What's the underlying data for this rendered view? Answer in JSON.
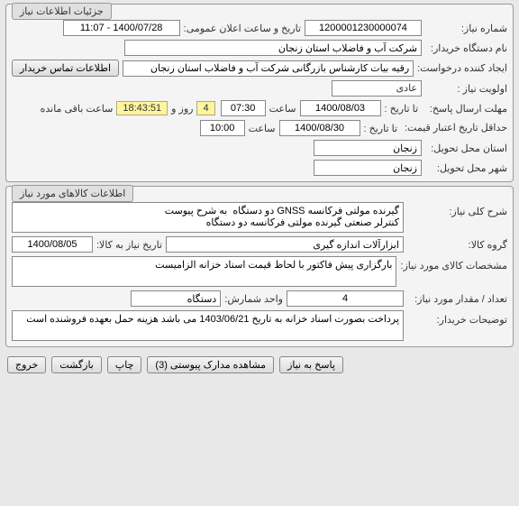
{
  "panel1": {
    "title": "جزئیات اطلاعات نیاز"
  },
  "need_no_label": "شماره نیاز:",
  "need_no": "1200001230000074",
  "public_date_label": "تاریخ و ساعت اعلان عمومی:",
  "public_date": "1400/07/28 - 11:07",
  "buyer_org_label": "نام دستگاه خریدار:",
  "buyer_org": "شرکت آب و فاضلاب استان زنجان",
  "creator_label": "ایجاد کننده درخواست:",
  "creator": "رقیه بیات کارشناس بازرگانی شرکت آب و فاضلاب استان زنجان",
  "contact_btn": "اطلاعات تماس خریدار",
  "priority_label": "اولویت نیاز :",
  "priority": "عادی",
  "response_deadline_label": "مهلت ارسال پاسخ:",
  "to_date": "تا تاریخ :",
  "resp_date": "1400/08/03",
  "time_label": "ساعت",
  "resp_time": "07:30",
  "remain_days": "4",
  "remain_word1": "روز و",
  "remain_time": "18:43:51",
  "remain_word2": "ساعت باقی مانده",
  "price_valid_label": "حداقل تاریخ اعتبار\nقیمت:",
  "price_date": "1400/08/30",
  "price_time": "10:00",
  "delivery_prov_label": "استان محل تحویل:",
  "delivery_prov": "زنجان",
  "delivery_city_label": "شهر محل تحویل:",
  "delivery_city": "زنجان",
  "panel2": {
    "title": "اطلاعات کالاهای مورد نیاز"
  },
  "desc_label": "شرح کلی نیاز:",
  "desc": "گیرنده مولتی فرکانسه GNSS دو دستگاه  به شرح پیوست\nکنترلر صنعتی گیرنده مولتی فرکانسه دو دستگاه",
  "group_label": "گروه کالا:",
  "group": "ابزارآلات اندازه گیری",
  "need_to_date_label": "تاریخ نیاز به کالا:",
  "need_to_date": "1400/08/05",
  "spec_label": "مشخصات کالای مورد نیاز:",
  "spec": "بارگزاری پیش فاکتور با لحاظ قیمت اسناد خزانه الزامیست",
  "qty_label": "تعداد / مقدار مورد نیاز:",
  "qty": "4",
  "unit_label": "واحد شمارش:",
  "unit": "دستگاه",
  "buyer_note_label": "توضیحات خریدار:",
  "buyer_note": "پرداخت بصورت اسناد خزانه به تاریخ 1403/06/21 می باشد هزینه حمل بعهده فروشنده است",
  "btn_respond": "پاسخ به نیاز",
  "btn_attach": "مشاهده مدارک پیوستی (3)",
  "btn_print": "چاپ",
  "btn_back": "بازگشت",
  "btn_exit": "خروج"
}
